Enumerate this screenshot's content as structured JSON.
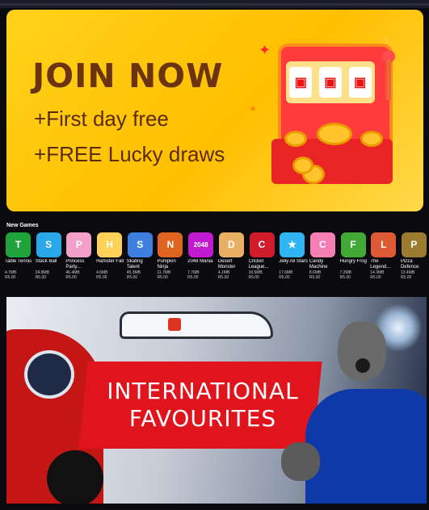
{
  "banner_join": {
    "headline": "JOIN NOW",
    "line1": "+First day free",
    "line2": "+FREE Lucky draws"
  },
  "new_games": {
    "title": "New Games",
    "items": [
      {
        "name": "Table Tennis",
        "size": "4.7MB",
        "price": "R5.00",
        "color": "#1fa33a",
        "icon": "T"
      },
      {
        "name": "Stack Ball",
        "size": "24.8MB",
        "price": "R5.00",
        "color": "#28a8e6",
        "icon": "S"
      },
      {
        "name": "Princess Party...",
        "size": "46.4MB",
        "price": "R5.00",
        "color": "#f2a0c9",
        "icon": "P"
      },
      {
        "name": "Hamster Fall",
        "size": "4.6MB",
        "price": "R5.00",
        "color": "#ffd257",
        "icon": "H"
      },
      {
        "name": "Skating Talent",
        "size": "45.3MB",
        "price": "R5.00",
        "color": "#3f7fe0",
        "icon": "S"
      },
      {
        "name": "Pumpkin Ninja",
        "size": "11.7MB",
        "price": "R5.00",
        "color": "#e0641f",
        "icon": "N"
      },
      {
        "name": "2048 Mania",
        "size": "7.7MB",
        "price": "R5.00",
        "color": "#c21ad1",
        "icon": "2048"
      },
      {
        "name": "Desert Monster",
        "size": "4.1MB",
        "price": "R5.00",
        "color": "#e9b064",
        "icon": "D"
      },
      {
        "name": "Cricket League...",
        "size": "18.5MB",
        "price": "R5.00",
        "color": "#d11d2b",
        "icon": "C"
      },
      {
        "name": "Jelly All Stars",
        "size": "17.6MB",
        "price": "R5.00",
        "color": "#30b5f2",
        "icon": "★"
      },
      {
        "name": "Candy Machine",
        "size": "8.6MB",
        "price": "R5.00",
        "color": "#f57eb5",
        "icon": "C"
      },
      {
        "name": "Hungry Frog",
        "size": "7.2MB",
        "price": "R5.00",
        "color": "#42a836",
        "icon": "F"
      },
      {
        "name": "The Legend...",
        "size": "14.3MB",
        "price": "R5.00",
        "color": "#dd5a35",
        "icon": "L"
      },
      {
        "name": "Pizza Defence",
        "size": "13.4MB",
        "price": "R5.00",
        "color": "#9a7b2f",
        "icon": "P"
      }
    ]
  },
  "banner_international": {
    "line1": "INTERNATIONAL",
    "line2": "FAVOURITES"
  }
}
